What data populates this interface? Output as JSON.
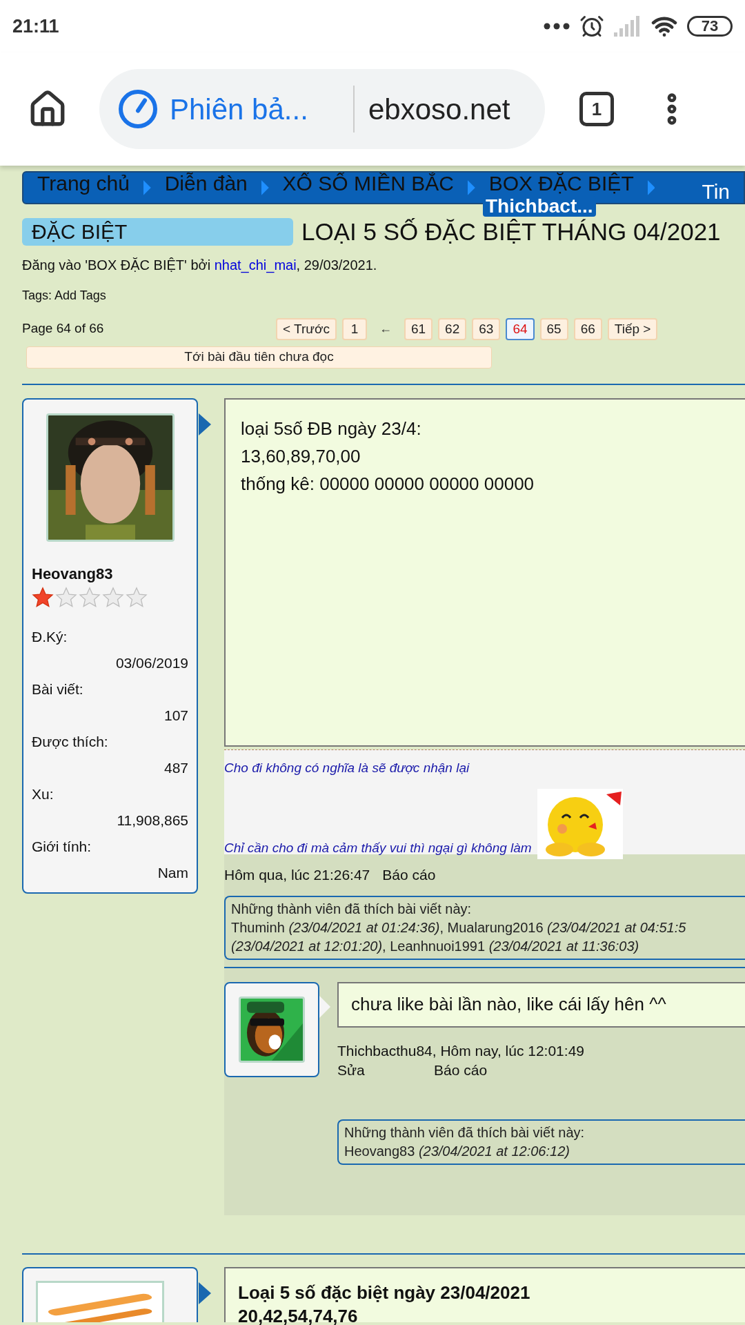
{
  "status_bar": {
    "time": "21:11",
    "battery": "73"
  },
  "browser": {
    "mode_label": "Phiên bả...",
    "url": "ebxoso.net",
    "tab_count": "1"
  },
  "breadcrumb": {
    "items": [
      "Trang chủ",
      "Diễn đàn",
      "XỔ SỐ MIỀN BẮC",
      "BOX ĐẶC BIỆT",
      "Tin"
    ],
    "overlay": "Thichbact..."
  },
  "thread": {
    "prefix": "ĐẶC BIỆT",
    "title": "LOẠI 5 SỐ ĐẶC BIỆT THÁNG 04/2021",
    "meta_before": "Đăng vào 'BOX ĐẶC BIỆT' bởi ",
    "author": "nhat_chi_mai",
    "meta_after": ", 29/03/2021.",
    "tags": "Tags: Add Tags"
  },
  "pagination": {
    "summary": "Page 64 of 66",
    "pages": [
      {
        "label": "< Trước",
        "kind": "button",
        "selected": false
      },
      {
        "label": "1",
        "kind": "button",
        "selected": false
      },
      {
        "label": "←",
        "kind": "text"
      },
      {
        "label": "61",
        "kind": "button",
        "selected": false
      },
      {
        "label": "62",
        "kind": "button",
        "selected": false
      },
      {
        "label": "63",
        "kind": "button",
        "selected": false
      },
      {
        "label": "64",
        "kind": "button",
        "selected": true
      },
      {
        "label": "65",
        "kind": "button",
        "selected": false
      },
      {
        "label": "66",
        "kind": "button",
        "selected": false
      },
      {
        "label": "Tiếp >",
        "kind": "button",
        "selected": false
      }
    ],
    "unread_button": "Tới bài đầu tiên chưa đọc"
  },
  "post": {
    "user": {
      "name": "Heovang83",
      "stars": 1,
      "stats": [
        {
          "label": "Đ.Ký:",
          "value": "03/06/2019"
        },
        {
          "label": "Bài viết:",
          "value": "107"
        },
        {
          "label": "Được thích:",
          "value": "487"
        },
        {
          "label": "Xu:",
          "value": "11,908,865"
        },
        {
          "label": "Giới tính:",
          "value": "Nam"
        }
      ]
    },
    "body_lines": [
      "loại 5số ĐB ngày 23/4:",
      "13,60,89,70,00",
      "thống kê: 00000 00000 00000 00000"
    ],
    "signature_lines": [
      "Cho đi không có nghĩa là sẽ được nhận lại",
      "Chỉ cần cho đi mà cảm thấy vui thì ngại gì không làm"
    ],
    "footer": {
      "time": "Hôm qua, lúc 21:26:47",
      "report": "Báo cáo"
    },
    "likes": {
      "heading": "Những thành viên đã thích bài viết này:",
      "lines": [
        "Thuminh *(23/04/2021 at 01:24:36)*, Mualarung2016 *(23/04/2021 at 04:51:5*",
        "*(23/04/2021 at 12:01:20)*, Leanhnuoi1991 *(23/04/2021 at 11:36:03)*"
      ]
    },
    "reply": {
      "text": "chưa like bài lần nào, like cái lấy hên ^^",
      "author_line": "Thichbacthu84, Hôm nay, lúc 12:01:49",
      "actions": [
        "Sửa",
        "Báo cáo"
      ],
      "likes": {
        "heading": "Những thành viên đã thích bài viết này:",
        "lines": [
          "Heovang83 *(23/04/2021 at 12:06:12)*"
        ]
      }
    }
  },
  "next_post": {
    "title": "Loại 5 số đặc biệt ngày 23/04/2021",
    "line": "20,42,54,74,76"
  }
}
